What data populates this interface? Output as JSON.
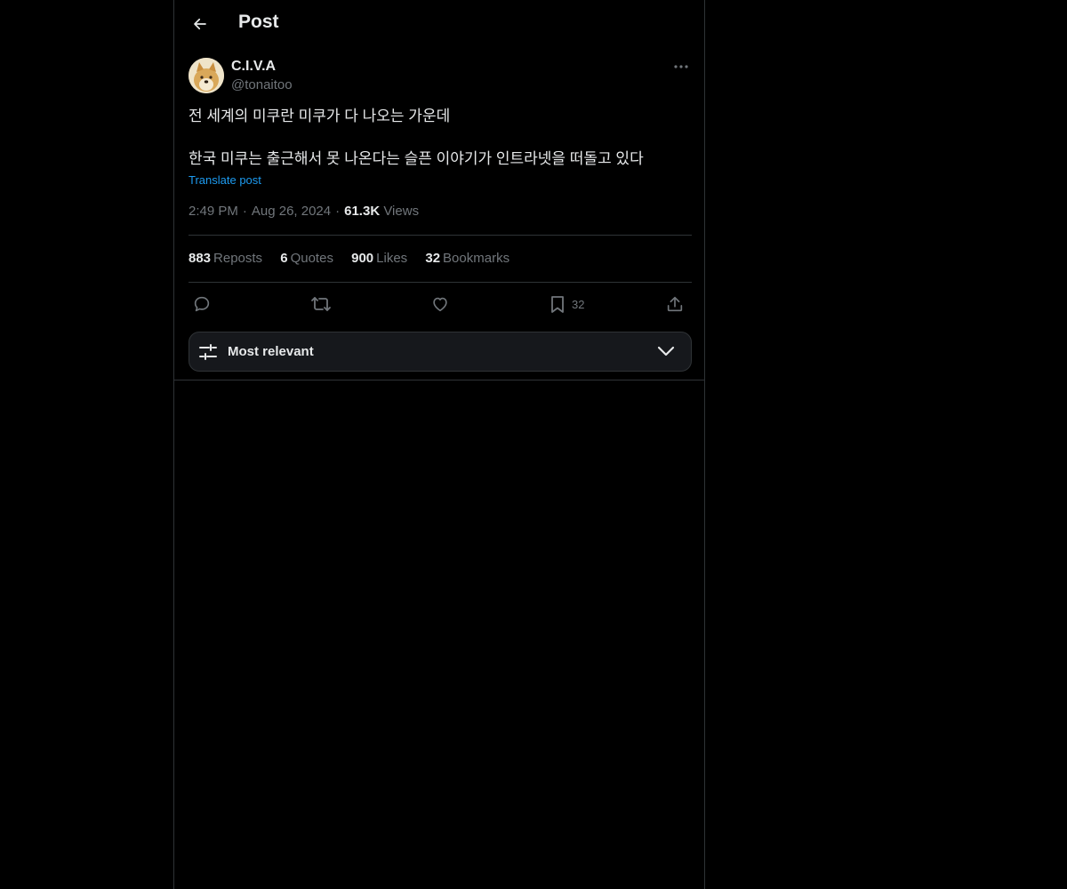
{
  "header": {
    "title": "Post",
    "back_icon": "arrow-left-icon"
  },
  "author": {
    "display_name": "C.I.V.A",
    "handle": "@tonaitoo",
    "avatar_icon": "doge-avatar"
  },
  "tweet": {
    "lines": [
      "전 세계의 미쿠란 미쿠가 다 나오는 가운데",
      "한국 미쿠는 출근해서 못 나온다는 슬픈 이야기가 인트라넷을 떠돌고 있다"
    ],
    "translate_label": "Translate post"
  },
  "meta": {
    "time": "2:49 PM",
    "separator": "·",
    "date": "Aug 26, 2024",
    "views_count": "61.3K",
    "views_label": "Views"
  },
  "stats": {
    "reposts_count": "883",
    "reposts_label": "Reposts",
    "quotes_count": "6",
    "quotes_label": "Quotes",
    "likes_count": "900",
    "likes_label": "Likes",
    "bookmarks_count": "32",
    "bookmarks_label": "Bookmarks"
  },
  "actions": {
    "bookmark_count": "32"
  },
  "sort": {
    "label": "Most relevant"
  },
  "colors": {
    "background": "#000000",
    "text": "#e7e9ea",
    "secondary": "#71767b",
    "accent": "#1d9bf0",
    "border": "#2f3336"
  }
}
